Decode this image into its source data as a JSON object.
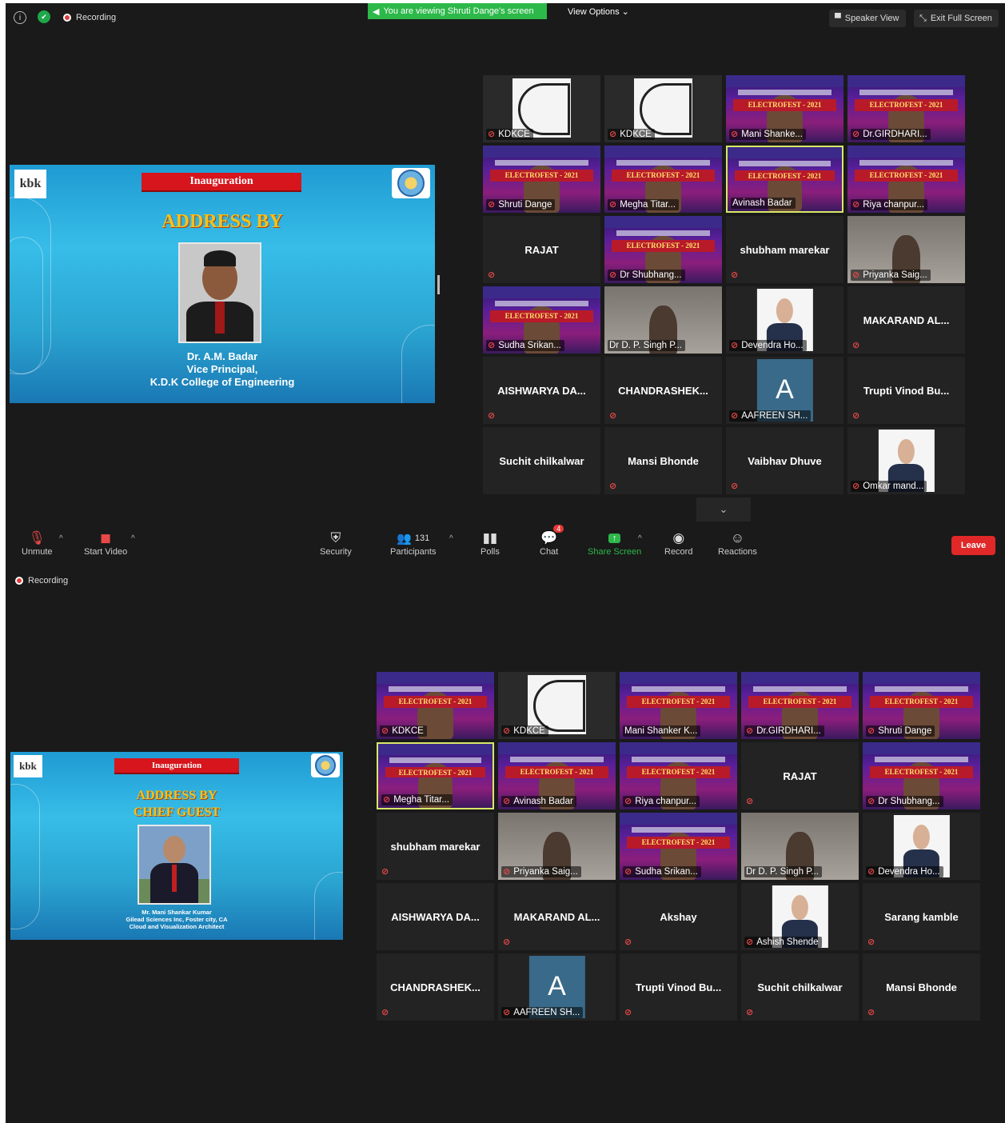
{
  "top_bar": {
    "recording": "Recording",
    "viewing_banner": "You are viewing Shruti Dange's screen",
    "view_options": "View Options",
    "speaker_view": "Speaker View",
    "exit_full_screen": "Exit Full Screen"
  },
  "slide1": {
    "ribbon": "Inauguration",
    "heading": "ADDRESS BY",
    "name": "Dr. A.M. Badar",
    "role": "Vice Principal,",
    "org": "K.D.K College of Engineering"
  },
  "slide2": {
    "ribbon": "Inauguration",
    "heading1": "ADDRESS BY",
    "heading2": "CHIEF GUEST",
    "name": "Mr. Mani Shankar Kumar",
    "company": "Gilead Sciences Inc, Foster city, CA",
    "role": "Cloud and Visualization Architect"
  },
  "grid1": [
    {
      "label": "KDKCE",
      "kind": "kdkce",
      "muted": true
    },
    {
      "label": "KDKCE",
      "kind": "kdkce",
      "muted": true
    },
    {
      "label": "Mani Shanke...",
      "kind": "banner",
      "muted": true
    },
    {
      "label": "Dr.GIRDHARI...",
      "kind": "banner",
      "muted": true
    },
    {
      "label": "Shruti Dange",
      "kind": "banner",
      "muted": true
    },
    {
      "label": "Megha Titar...",
      "kind": "banner",
      "muted": true
    },
    {
      "label": "Avinash Badar",
      "kind": "banner",
      "muted": false,
      "active": true
    },
    {
      "label": "Riya chanpur...",
      "kind": "banner",
      "muted": true
    },
    {
      "name": "RAJAT",
      "kind": "name",
      "muted": true
    },
    {
      "label": "Dr Shubhang...",
      "kind": "banner",
      "muted": true
    },
    {
      "name": "shubham marekar",
      "kind": "name",
      "muted": true
    },
    {
      "label": "Priyanka Saig...",
      "kind": "cam",
      "muted": true
    },
    {
      "label": "Sudha Srikan...",
      "kind": "banner",
      "muted": true
    },
    {
      "label": "Dr D. P. Singh P...",
      "kind": "cam",
      "muted": false
    },
    {
      "label": "Devendra Ho...",
      "kind": "photo",
      "muted": true
    },
    {
      "name": "MAKARAND AL...",
      "kind": "name",
      "muted": true
    },
    {
      "name": "AISHWARYA DA...",
      "kind": "name",
      "muted": true
    },
    {
      "name": "CHANDRASHEK...",
      "kind": "name",
      "muted": true
    },
    {
      "label": "AAFREEN SH...",
      "kind": "avatar",
      "avatar": "A",
      "muted": true
    },
    {
      "name": "Trupti Vinod Bu...",
      "kind": "name",
      "muted": true
    },
    {
      "name": "Suchit chilkalwar",
      "kind": "name",
      "muted": false
    },
    {
      "name": "Mansi Bhonde",
      "kind": "name",
      "muted": true
    },
    {
      "name": "Vaibhav Dhuve",
      "kind": "name",
      "muted": true
    },
    {
      "label": "Omkar mand...",
      "kind": "photo",
      "muted": true
    }
  ],
  "grid2": [
    {
      "label": "KDKCE",
      "kind": "banner",
      "muted": true
    },
    {
      "label": "KDKCE",
      "kind": "kdkce",
      "muted": true
    },
    {
      "label": "Mani Shanker K...",
      "kind": "banner",
      "muted": false
    },
    {
      "label": "Dr.GIRDHARI...",
      "kind": "banner",
      "muted": true
    },
    {
      "label": "Shruti Dange",
      "kind": "banner",
      "muted": true
    },
    {
      "label": "Megha Titar...",
      "kind": "banner",
      "muted": true,
      "active": true
    },
    {
      "label": "Avinash Badar",
      "kind": "banner",
      "muted": true
    },
    {
      "label": "Riya chanpur...",
      "kind": "banner",
      "muted": true
    },
    {
      "name": "RAJAT",
      "kind": "name",
      "muted": true
    },
    {
      "label": "Dr Shubhang...",
      "kind": "banner",
      "muted": true
    },
    {
      "name": "shubham marekar",
      "kind": "name",
      "muted": true
    },
    {
      "label": "Priyanka Saig...",
      "kind": "cam",
      "muted": true
    },
    {
      "label": "Sudha Srikan...",
      "kind": "banner",
      "muted": true
    },
    {
      "label": "Dr D. P. Singh P...",
      "kind": "cam",
      "muted": false
    },
    {
      "label": "Devendra Ho...",
      "kind": "photo",
      "muted": true
    },
    {
      "name": "AISHWARYA DA...",
      "kind": "name",
      "muted": false
    },
    {
      "name": "MAKARAND AL...",
      "kind": "name",
      "muted": true
    },
    {
      "name": "Akshay",
      "kind": "name",
      "muted": true
    },
    {
      "label": "Ashish Shende",
      "kind": "photo",
      "muted": true
    },
    {
      "name": "Sarang kamble",
      "kind": "name",
      "muted": true
    },
    {
      "name": "CHANDRASHEK...",
      "kind": "name",
      "muted": true
    },
    {
      "label": "AAFREEN SH...",
      "kind": "avatar",
      "avatar": "A",
      "muted": true
    },
    {
      "name": "Trupti Vinod Bu...",
      "kind": "name",
      "muted": true
    },
    {
      "name": "Suchit chilkalwar",
      "kind": "name",
      "muted": true
    },
    {
      "name": "Mansi Bhonde",
      "kind": "name",
      "muted": true
    }
  ],
  "banner_text": "ELECTROFEST - 2021",
  "toolbar": {
    "unmute": "Unmute",
    "start_video": "Start Video",
    "security": "Security",
    "participants": "Participants",
    "participants_count": "131",
    "polls": "Polls",
    "chat": "Chat",
    "chat_badge": "4",
    "share_screen": "Share Screen",
    "record": "Record",
    "reactions": "Reactions",
    "leave": "Leave"
  },
  "colors": {
    "background": "#1a1a1a",
    "tile": "#232323",
    "active_border": "#d8e868",
    "share_green": "#2db84a",
    "leave_red": "#e02828"
  }
}
